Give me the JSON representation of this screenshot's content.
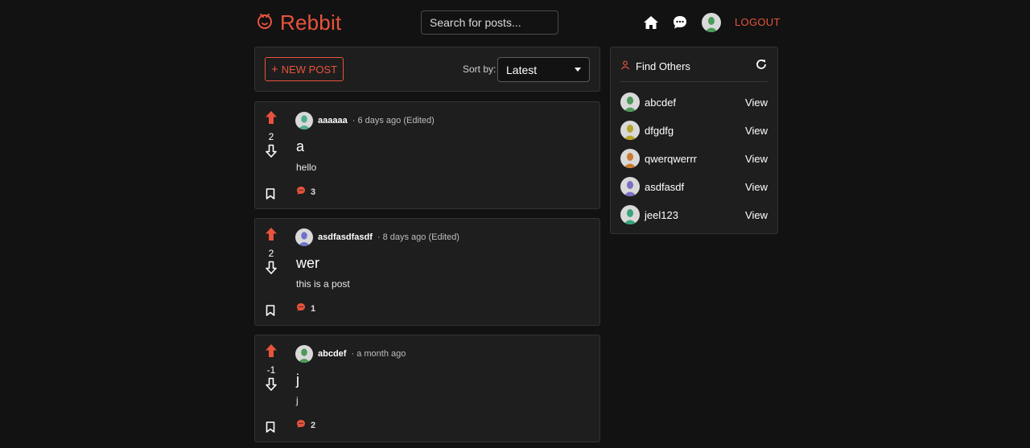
{
  "header": {
    "brand": "Rebbit",
    "search_placeholder": "Search for posts...",
    "logout_label": "LOGOUT"
  },
  "toolbar": {
    "new_post_label": "NEW POST",
    "sort_label": "Sort by:",
    "sort_value": "Latest"
  },
  "posts": [
    {
      "score": "2",
      "author": "aaaaaa",
      "meta": "· 6 days ago (Edited)",
      "title": "a",
      "body": "hello",
      "comments": "3",
      "avatar_color": "#4fae8a"
    },
    {
      "score": "2",
      "author": "asdfasdfasdf",
      "meta": "· 8 days ago (Edited)",
      "title": "wer",
      "body": "this is a post",
      "comments": "1",
      "avatar_color": "#6f72c9"
    },
    {
      "score": "-1",
      "author": "abcdef",
      "meta": "· a month ago",
      "title": "j",
      "body": "j",
      "comments": "2",
      "avatar_color": "#4c9a5a"
    }
  ],
  "sidebar": {
    "title": "Find Others",
    "users": [
      {
        "name": "abcdef",
        "action": "View",
        "avatar_color": "#4c9a5a"
      },
      {
        "name": "dfgdfg",
        "action": "View",
        "avatar_color": "#b6a32a"
      },
      {
        "name": "qwerqwerrr",
        "action": "View",
        "avatar_color": "#c97a2e"
      },
      {
        "name": "asdfasdf",
        "action": "View",
        "avatar_color": "#7a6fc4"
      },
      {
        "name": "jeel123",
        "action": "View",
        "avatar_color": "#3aa37a"
      }
    ]
  },
  "colors": {
    "accent": "#e8533d",
    "background": "#121212",
    "card": "#1e1e1e"
  },
  "icons": [
    "logo-icon",
    "home-icon",
    "chat-icon",
    "avatar",
    "plus-icon",
    "upvote-icon",
    "downvote-icon",
    "bookmark-icon",
    "comment-icon",
    "person-icon",
    "refresh-icon"
  ]
}
